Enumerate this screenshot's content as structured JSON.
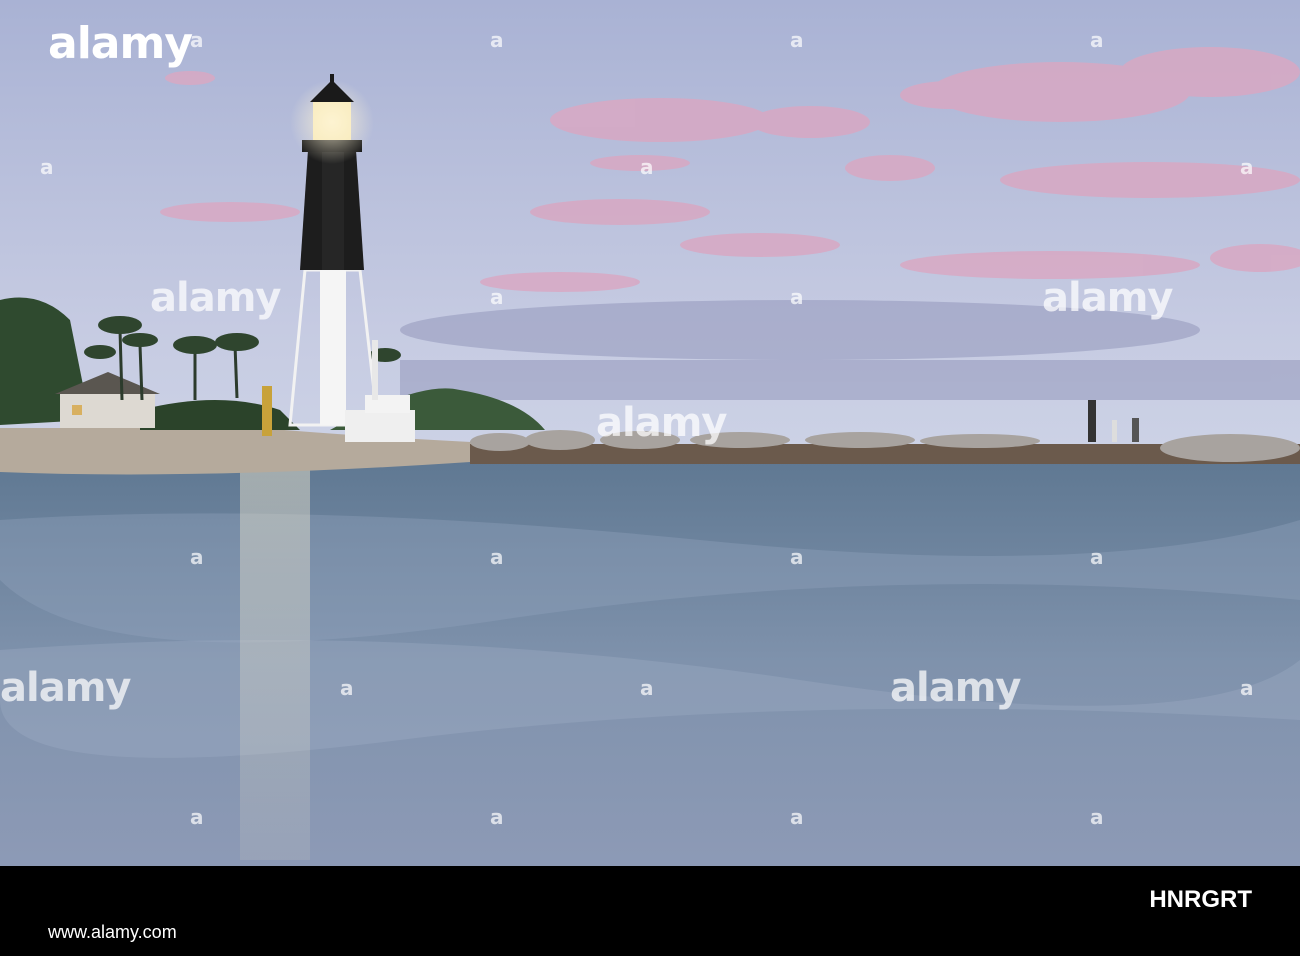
{
  "photo": {
    "subject": "lighthouse",
    "colors": {
      "sky_top": "#aeb6d6",
      "sky_bottom": "#c8cde4",
      "cloud": "#d9a9c2",
      "water": "#6f86a0",
      "sand": "#b8ad9f"
    }
  },
  "watermarks": {
    "text": "alamy",
    "letter": "a"
  },
  "footer": {
    "logo": "alamy",
    "url": "www.alamy.com",
    "image_id": "HNRGRT"
  }
}
